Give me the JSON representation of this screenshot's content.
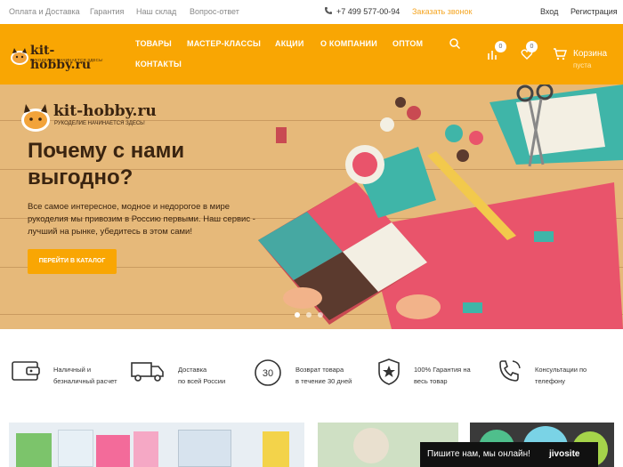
{
  "topbar": {
    "links": [
      "Оплата и Доставка",
      "Гарантия",
      "Наш склад",
      "Вопрос-ответ"
    ],
    "phone": "+7 499 577-00-94",
    "callback": "Заказать звонок",
    "login": "Вход",
    "register": "Регистрация"
  },
  "header": {
    "logo_text": "kit-hobby.ru",
    "logo_tagline": "РУКОДЕЛИЕ НАЧИНАЕТСЯ ЗДЕСЬ!",
    "nav": [
      "ТОВАРЫ",
      "МАСТЕР-КЛАССЫ",
      "АКЦИИ",
      "О КОМПАНИИ",
      "ОПТОМ",
      "КОНТАКТЫ"
    ],
    "compare_count": "0",
    "favorites_count": "0",
    "cart_label": "Корзина",
    "cart_status": "пуста",
    "accent_color": "#f9a603"
  },
  "hero": {
    "logo_text": "kit-hobby.ru",
    "logo_tagline": "РУКОДЕЛИЕ НАЧИНАЕТСЯ ЗДЕСЬ!",
    "title": "Почему с нами выгодно?",
    "text": "Все самое интересное, модное и недорогое в мире рукоделия мы привозим в Россию первыми. Наш сервис - лучший на рынке, убедитесь в этом сами!",
    "button": "ПЕРЕЙТИ В КАТАЛОГ",
    "slides_count": 3,
    "active_slide": 1
  },
  "features": [
    {
      "icon": "wallet-card-icon",
      "line1": "Наличный и",
      "line2": "безналичный расчет"
    },
    {
      "icon": "delivery-truck-icon",
      "line1": "Доставка",
      "line2": "по всей России"
    },
    {
      "icon": "return-30-icon",
      "line1": "Возврат товара",
      "line2": "в течение 30 дней"
    },
    {
      "icon": "guarantee-star-icon",
      "line1": "100% Гарантия на",
      "line2": "весь товар"
    },
    {
      "icon": "phone-consult-icon",
      "line1": "Консультации по",
      "line2": "телефону"
    }
  ],
  "chat": {
    "text": "Пишите нам, мы онлайн!",
    "brand": "jivosite"
  }
}
